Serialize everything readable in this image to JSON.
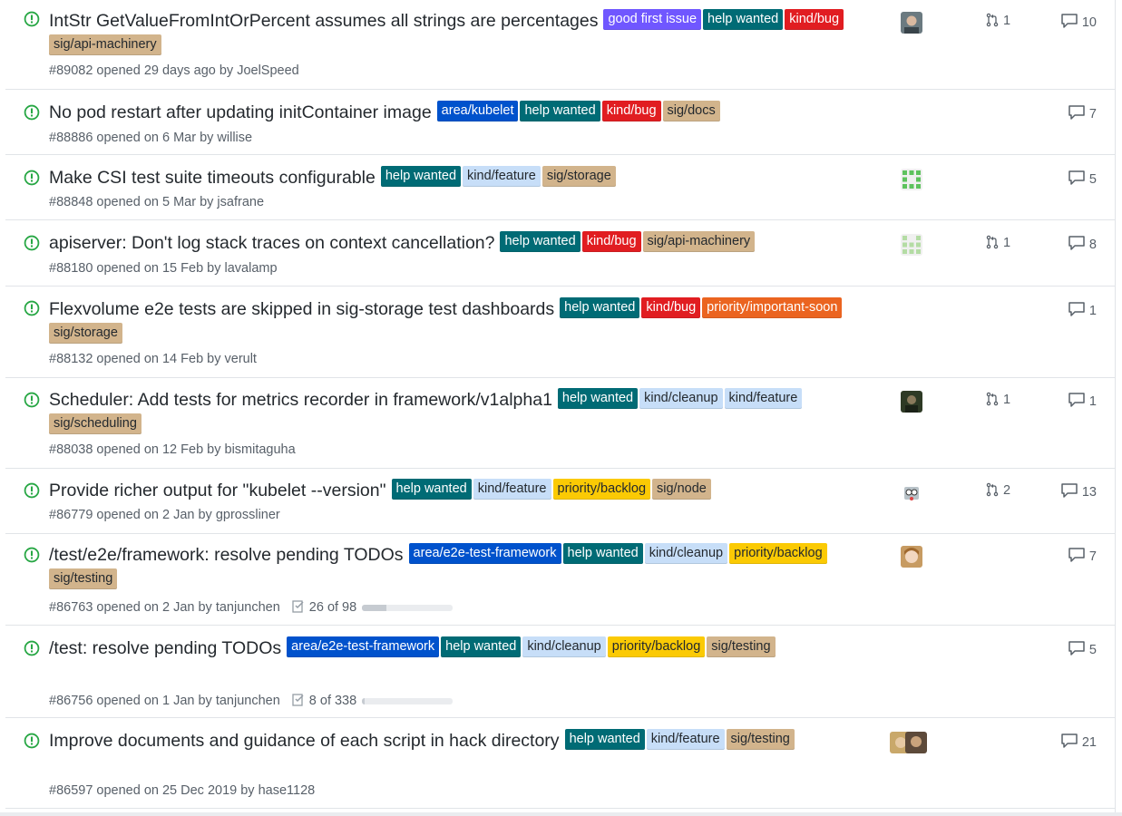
{
  "colors": {
    "open": "#28a745",
    "good_first_issue": "#7057ff",
    "help_wanted": "#006b75",
    "kind_bug": "#e11d21",
    "sig": "#d2b48c",
    "area": "#0052cc",
    "kind_light": "#c7def8",
    "priority_important_soon": "#eb6420",
    "priority_backlog": "#fbca04"
  },
  "issues": [
    {
      "title": "IntStr GetValueFromIntOrPercent assumes all strings are percentages",
      "labels": [
        {
          "text": "good first issue",
          "bg": "#7057ff",
          "fg": "#ffffff"
        },
        {
          "text": "help wanted",
          "bg": "#006b75",
          "fg": "#ffffff"
        },
        {
          "text": "kind/bug",
          "bg": "#e11d21",
          "fg": "#ffffff"
        },
        {
          "text": "sig/api-machinery",
          "bg": "#d2b48c",
          "fg": "#24292e"
        }
      ],
      "meta": "#89082 opened 29 days ago by JoelSpeed",
      "avatars": [
        "avatar-joelspeed"
      ],
      "linked_prs": "1",
      "comments": "10"
    },
    {
      "title": "No pod restart after updating initContainer image",
      "labels": [
        {
          "text": "area/kubelet",
          "bg": "#0052cc",
          "fg": "#ffffff"
        },
        {
          "text": "help wanted",
          "bg": "#006b75",
          "fg": "#ffffff"
        },
        {
          "text": "kind/bug",
          "bg": "#e11d21",
          "fg": "#ffffff"
        },
        {
          "text": "sig/docs",
          "bg": "#d2b48c",
          "fg": "#24292e"
        }
      ],
      "meta": "#88886 opened on 6 Mar by willise",
      "avatars": [],
      "linked_prs": "",
      "comments": "7"
    },
    {
      "title": "Make CSI test suite timeouts configurable",
      "labels": [
        {
          "text": "help wanted",
          "bg": "#006b75",
          "fg": "#ffffff"
        },
        {
          "text": "kind/feature",
          "bg": "#c7def8",
          "fg": "#24292e"
        },
        {
          "text": "sig/storage",
          "bg": "#d2b48c",
          "fg": "#24292e"
        }
      ],
      "meta": "#88848 opened on 5 Mar by jsafrane",
      "avatars": [
        "avatar-identicon-green"
      ],
      "linked_prs": "",
      "comments": "5"
    },
    {
      "title": "apiserver: Don't log stack traces on context cancellation?",
      "labels": [
        {
          "text": "help wanted",
          "bg": "#006b75",
          "fg": "#ffffff"
        },
        {
          "text": "kind/bug",
          "bg": "#e11d21",
          "fg": "#ffffff"
        },
        {
          "text": "sig/api-machinery",
          "bg": "#d2b48c",
          "fg": "#24292e"
        }
      ],
      "meta": "#88180 opened on 15 Feb by lavalamp",
      "avatars": [
        "avatar-identicon-lightgreen"
      ],
      "linked_prs": "1",
      "comments": "8"
    },
    {
      "title": "Flexvolume e2e tests are skipped in sig-storage test dashboards",
      "labels": [
        {
          "text": "help wanted",
          "bg": "#006b75",
          "fg": "#ffffff"
        },
        {
          "text": "kind/bug",
          "bg": "#e11d21",
          "fg": "#ffffff"
        },
        {
          "text": "priority/important-soon",
          "bg": "#eb6420",
          "fg": "#ffffff"
        },
        {
          "text": "sig/storage",
          "bg": "#d2b48c",
          "fg": "#24292e"
        }
      ],
      "meta": "#88132 opened on 14 Feb by verult",
      "avatars": [],
      "linked_prs": "",
      "comments": "1"
    },
    {
      "title": "Scheduler: Add tests for metrics recorder in framework/v1alpha1",
      "labels": [
        {
          "text": "help wanted",
          "bg": "#006b75",
          "fg": "#ffffff"
        },
        {
          "text": "kind/cleanup",
          "bg": "#c7def8",
          "fg": "#24292e"
        },
        {
          "text": "kind/feature",
          "bg": "#c7def8",
          "fg": "#24292e"
        },
        {
          "text": "sig/scheduling",
          "bg": "#d2b48c",
          "fg": "#24292e"
        }
      ],
      "meta": "#88038 opened on 12 Feb by bismitaguha",
      "avatars": [
        "avatar-dark"
      ],
      "linked_prs": "1",
      "comments": "1"
    },
    {
      "title": "Provide richer output for \"kubelet --version\"",
      "labels": [
        {
          "text": "help wanted",
          "bg": "#006b75",
          "fg": "#ffffff"
        },
        {
          "text": "kind/feature",
          "bg": "#c7def8",
          "fg": "#24292e"
        },
        {
          "text": "priority/backlog",
          "bg": "#fbca04",
          "fg": "#24292e"
        },
        {
          "text": "sig/node",
          "bg": "#d2b48c",
          "fg": "#24292e"
        }
      ],
      "meta": "#86779 opened on 2 Jan by gprossliner",
      "avatars": [
        "avatar-robot"
      ],
      "linked_prs": "2",
      "comments": "13"
    },
    {
      "title": "/test/e2e/framework: resolve pending TODOs",
      "labels": [
        {
          "text": "area/e2e-test-framework",
          "bg": "#0052cc",
          "fg": "#ffffff"
        },
        {
          "text": "help wanted",
          "bg": "#006b75",
          "fg": "#ffffff"
        },
        {
          "text": "kind/cleanup",
          "bg": "#c7def8",
          "fg": "#24292e"
        },
        {
          "text": "priority/backlog",
          "bg": "#fbca04",
          "fg": "#24292e"
        },
        {
          "text": "sig/testing",
          "bg": "#d2b48c",
          "fg": "#24292e"
        }
      ],
      "meta": "#86763 opened on 2 Jan by tanjunchen",
      "tasks": {
        "text": "26 of 98",
        "done": 26,
        "total": 98
      },
      "avatars": [
        "avatar-girl"
      ],
      "linked_prs": "",
      "comments": "7"
    },
    {
      "title": "/test: resolve pending TODOs",
      "labels": [
        {
          "text": "area/e2e-test-framework",
          "bg": "#0052cc",
          "fg": "#ffffff"
        },
        {
          "text": "help wanted",
          "bg": "#006b75",
          "fg": "#ffffff"
        },
        {
          "text": "kind/cleanup",
          "bg": "#c7def8",
          "fg": "#24292e"
        },
        {
          "text": "priority/backlog",
          "bg": "#fbca04",
          "fg": "#24292e"
        },
        {
          "text": "sig/testing",
          "bg": "#d2b48c",
          "fg": "#24292e"
        }
      ],
      "meta": "#86756 opened on 1 Jan by tanjunchen",
      "tasks": {
        "text": "8 of 338",
        "done": 8,
        "total": 338
      },
      "avatars": [],
      "linked_prs": "",
      "comments": "5"
    },
    {
      "title": "Improve documents and guidance of each script in hack directory",
      "labels": [
        {
          "text": "help wanted",
          "bg": "#006b75",
          "fg": "#ffffff"
        },
        {
          "text": "kind/feature",
          "bg": "#c7def8",
          "fg": "#24292e"
        },
        {
          "text": "sig/testing",
          "bg": "#d2b48c",
          "fg": "#24292e"
        }
      ],
      "meta": "#86597 opened on 25 Dec 2019 by hase1128",
      "avatars": [
        "avatar-hase1128-a",
        "avatar-hase1128-b"
      ],
      "linked_prs": "",
      "comments": "21"
    }
  ]
}
